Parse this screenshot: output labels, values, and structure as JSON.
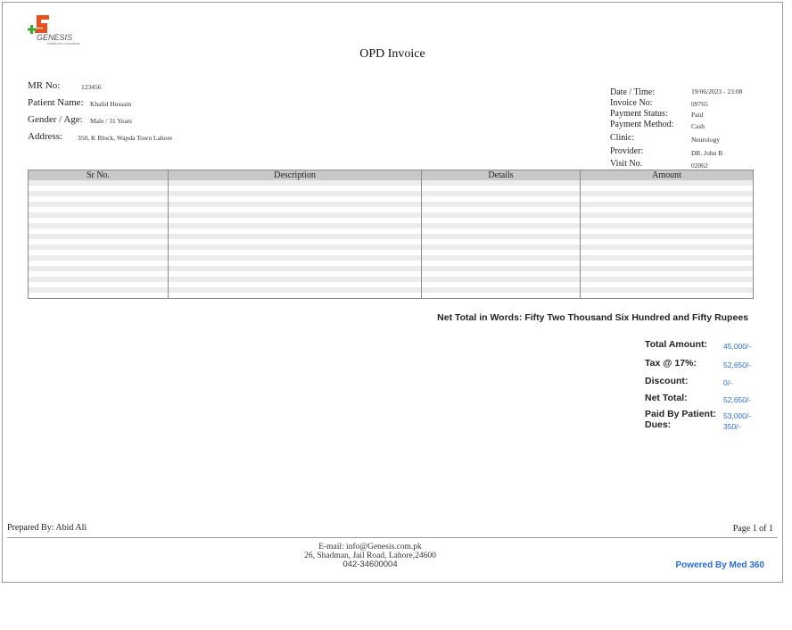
{
  "brand": {
    "name": "GENESIS",
    "tagline": "Healthcare Consultants"
  },
  "title": "OPD Invoice",
  "patient": {
    "mr_label": "MR No:",
    "mr_value": "123456",
    "name_label": "Patient Name:",
    "name_value": "Khalid Hussain",
    "gender_label": "Gender / Age:",
    "gender_value": "Male / 31 Years",
    "address_label": "Address:",
    "address_value": "350, K Block, Wapda Town Lahore"
  },
  "invoice": {
    "date_label": "Date / Time:",
    "date_value": "19/06/2023 - 23:08",
    "invoice_label": "Invoice No:",
    "invoice_value": "09765",
    "status_label": "Payment Status:",
    "status_value": "Paid",
    "method_label": "Payment Method:",
    "method_value": "Cash",
    "clinic_label": "Clinic:",
    "clinic_value": "Neurology",
    "provider_label": "Provider:",
    "provider_value": "DR. John B",
    "visit_label": "Visit No.",
    "visit_value": "02062"
  },
  "table": {
    "headers": [
      "Sr No.",
      "Description",
      "Details",
      "Amount"
    ]
  },
  "totals": {
    "words": "Net Total in Words: Fifty Two Thousand Six Hundred and Fifty Rupees",
    "total_label": "Total Amount:",
    "total_value": "45,000/-",
    "tax_label": "Tax @ 17%:",
    "tax_value": "52,650/-",
    "discount_label": "Discount:",
    "discount_value": "0/-",
    "net_label": "Net Total:",
    "net_value": "52,650/-",
    "paid_label": "Paid By Patient:",
    "paid_value": "53,000/-",
    "dues_label": "Dues:",
    "dues_value": "350/-"
  },
  "footer": {
    "prepared": "Prepared By: Abid Ali",
    "page": "Page 1 of 1",
    "email": "E-mail: info@Genesis.com.pk",
    "address": "26, Shadman, Jail Road, Lahore,24600",
    "phone": "042-34600004",
    "powered": "Powered By Med 360"
  },
  "colors": {
    "accent": "#2a6fd6",
    "logo_orange": "#e8501e",
    "logo_green": "#3aa835"
  }
}
